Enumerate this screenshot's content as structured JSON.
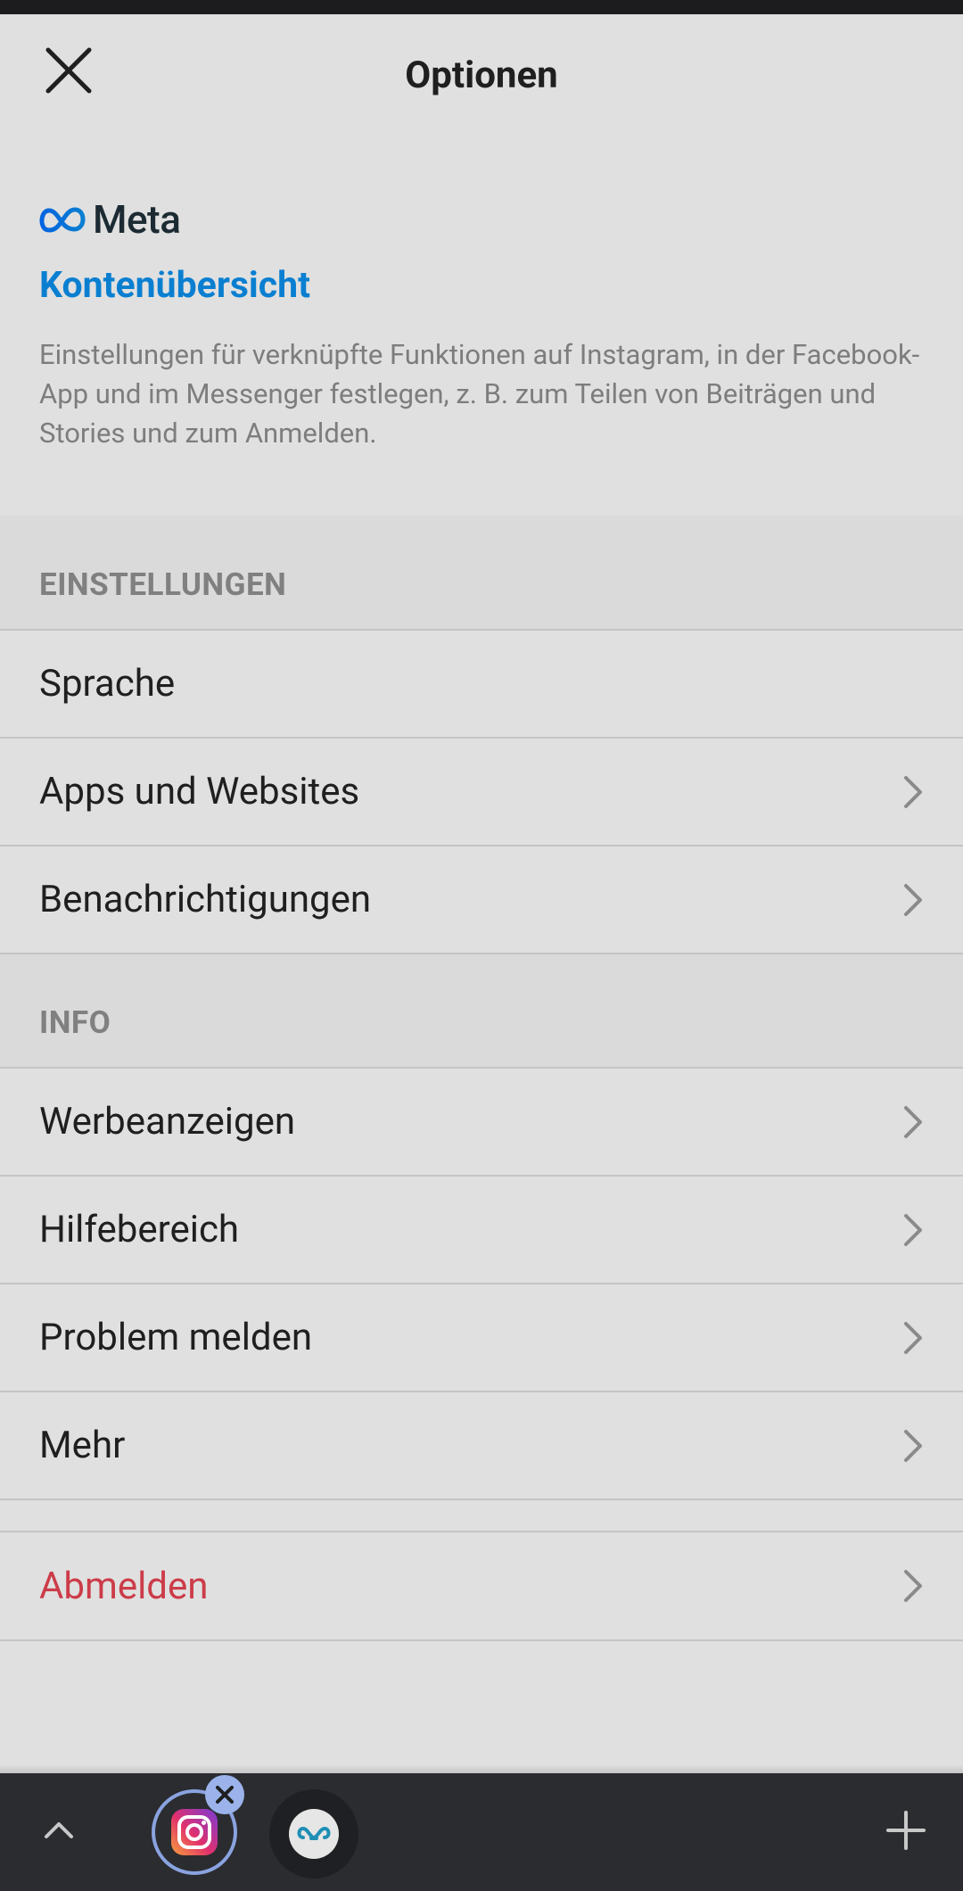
{
  "header": {
    "title": "Optionen"
  },
  "meta": {
    "brand": "Meta"
  },
  "accounts_center": {
    "title": "Kontenübersicht",
    "description": "Einstellungen für verknüpfte Funktionen auf Instagram, in der Facebook-App und im Messenger festlegen, z. B. zum Teilen von Beiträgen und Stories und zum Anmelden."
  },
  "sections": {
    "settings": {
      "header": "EINSTELLUNGEN",
      "items": [
        "Sprache",
        "Apps und Websites",
        "Benachrichtigungen"
      ]
    },
    "info": {
      "header": "INFO",
      "items": [
        "Werbeanzeigen",
        "Hilfebereich",
        "Problem melden",
        "Mehr"
      ]
    }
  },
  "logout": {
    "label": "Abmelden"
  },
  "colors": {
    "accent_blue": "#0a7fd1",
    "logout_red": "#cc3c48",
    "background": "#e0e0e0",
    "bottom_bar": "#2b2c30"
  },
  "icons": {
    "close": "close-icon",
    "chevron": "chevron-right-icon",
    "meta": "meta-logo-icon",
    "instagram": "instagram-icon",
    "second_app": "app-icon",
    "caret": "chevron-up-icon",
    "add": "plus-icon"
  }
}
